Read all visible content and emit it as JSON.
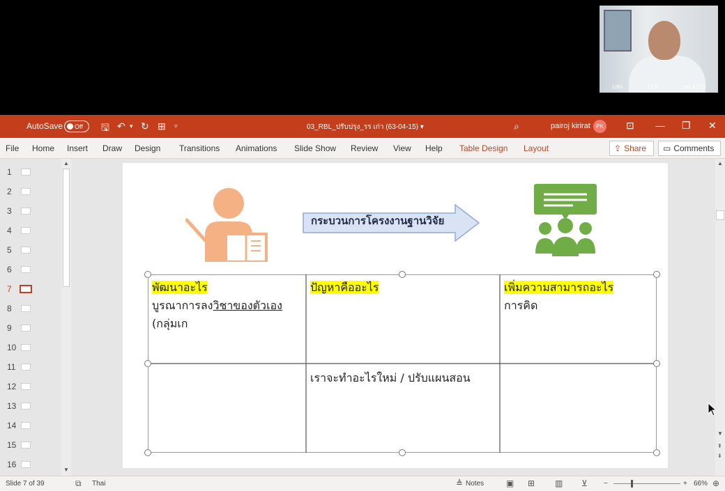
{
  "webcam": {
    "shutter": "1/60",
    "aperture": "F2.8",
    "iso": "ISO AUTO"
  },
  "titlebar": {
    "autosave_label": "AutoSave",
    "autosave_state": "Off",
    "filename": "03_RBL_ปรับปรุง_รร เก่า (63-04-15)",
    "filename_caret": "▾",
    "user_name": "pairoj kirirat",
    "user_initials": "PK"
  },
  "ribbon": {
    "tabs": [
      "File",
      "Home",
      "Insert",
      "Draw",
      "Design",
      "Transitions",
      "Animations",
      "Slide Show",
      "Review",
      "View",
      "Help",
      "Table Design",
      "Layout"
    ],
    "share_label": "Share",
    "comments_label": "Comments"
  },
  "thumbnails": {
    "numbers": [
      "1",
      "2",
      "3",
      "4",
      "5",
      "6",
      "7",
      "8",
      "9",
      "10",
      "11",
      "12",
      "13",
      "14",
      "15",
      "16"
    ],
    "active_index": 7
  },
  "slide": {
    "arrow_text": "กระบวนการโครงงานฐานวิจัย",
    "table": {
      "r1c1_header": "พัฒนาอะไร",
      "r1c1_line1a": "บูรณาการลง",
      "r1c1_line1b": "วิชาของตัวเอง",
      "r1c1_line2": "(กลุ่มเก",
      "r1c2_header": "ปัญหาคืออะไร",
      "r1c3_header": "เพิ่มความสามารถอะไร",
      "r1c3_line1": "การคิด",
      "r2c2_text": "เราจะทำอะไรใหม่ / ปรับแผนสอน"
    },
    "colors": {
      "teacher_icon": "#f4b183",
      "group_icon": "#70ad47",
      "arrow_fill": "#dae3f3",
      "arrow_stroke": "#8faadc",
      "highlight": "#ffff00"
    }
  },
  "statusbar": {
    "slide_info": "Slide 7 of 39",
    "language": "Thai",
    "notes_label": "Notes",
    "zoom_level": "66%",
    "zoom_minus": "−",
    "zoom_plus": "+"
  }
}
